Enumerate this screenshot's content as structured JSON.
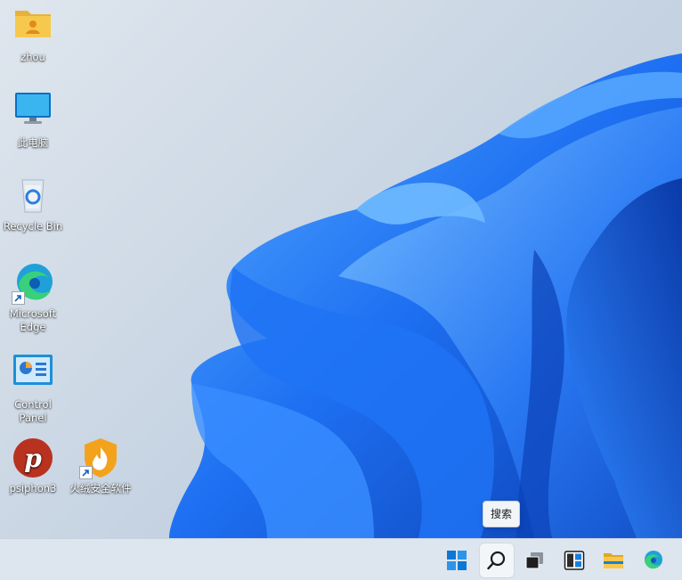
{
  "desktop": {
    "icons": [
      {
        "label": "zhou"
      },
      {
        "label": "此电脑"
      },
      {
        "label": "Recycle Bin"
      },
      {
        "label": "Microsoft Edge"
      },
      {
        "label": "Control Panel"
      },
      {
        "label": "psiphon3"
      },
      {
        "label": "火绒安全软件"
      }
    ]
  },
  "tooltip": {
    "text": "搜索"
  },
  "taskbar": {
    "buttons": [
      {
        "icon": "windows-start-icon"
      },
      {
        "icon": "search-icon",
        "active": true
      },
      {
        "icon": "task-view-icon"
      },
      {
        "icon": "widgets-icon"
      },
      {
        "icon": "file-explorer-icon"
      },
      {
        "icon": "edge-icon"
      }
    ]
  },
  "colors": {
    "wallpaper_blue": "#1a6cf0",
    "taskbar": "#dde5ee",
    "accent": "#0067c0"
  }
}
